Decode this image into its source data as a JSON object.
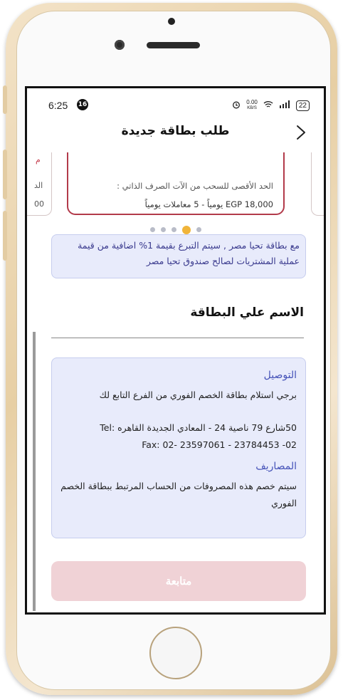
{
  "status_bar": {
    "time": "6:25",
    "notification_count": "16",
    "speed": "0.00",
    "speed_unit": "KB/S",
    "battery": "22"
  },
  "header": {
    "title": "طلب بطاقة جديدة",
    "back_icon": "chevron-right-icon"
  },
  "carousel": {
    "card_withdraw_limit_label": "الحد الأقصى للسحب من الآت الصرف الذاتي :",
    "card_withdraw_limit_value": "EGP 18,000 يومياً - 5 معاملات يومياً",
    "left_card_t1": "م",
    "left_card_t2": "الد",
    "left_card_t3": "00",
    "active_dot_index": 3,
    "dot_count": 5
  },
  "info_box": {
    "text": "مع بطاقة تحيا مصر , سيتم التبرع بقيمة 1% اضافية من قيمة عملية المشتريات لصالح صندوق تحيا مصر"
  },
  "card_name_section": {
    "title": "الاسم علي البطاقة"
  },
  "delivery": {
    "heading": "التوصيل",
    "text": "برجي استلام بطاقة الخصم الفوري من الفرع التابع لك",
    "address_line1": "50شارع 79 ناصية 24 - المعادي الجديدة القاهره :Tel",
    "address_line2": "02- 23784453 - Fax: 02- 23597061",
    "fees_heading": "المصاريف",
    "fees_text": "سيتم خصم هذه المصروفات من الحساب المرتبط ببطاقة الخصم الفوري"
  },
  "continue_button": {
    "label": "متابعة"
  },
  "colors": {
    "accent_red": "#b23a4a",
    "info_bg": "#e8ebfb",
    "heading_blue": "#4552b8",
    "dot_active": "#f0b43a",
    "button_disabled": "#f0d2d6"
  }
}
